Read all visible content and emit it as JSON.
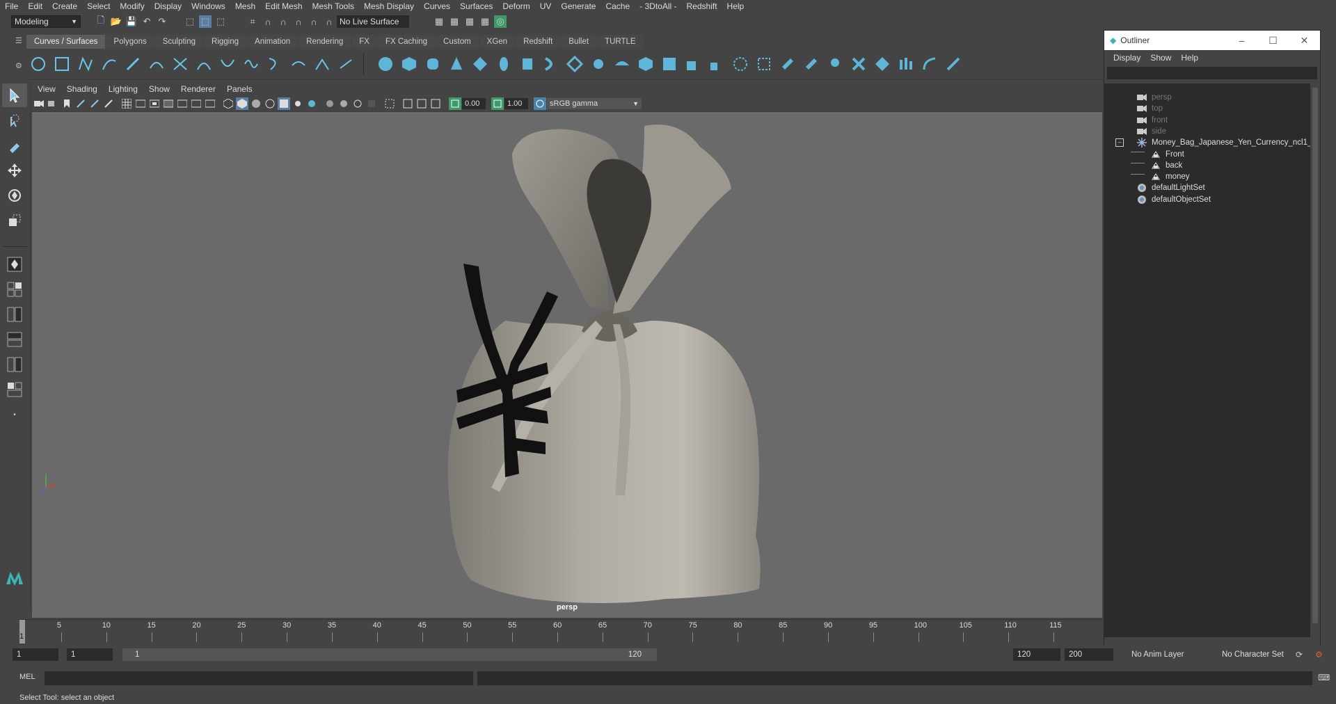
{
  "menubar": {
    "items": [
      "File",
      "Edit",
      "Create",
      "Select",
      "Modify",
      "Display",
      "Windows",
      "Mesh",
      "Edit Mesh",
      "Mesh Tools",
      "Mesh Display",
      "Curves",
      "Surfaces",
      "Deform",
      "UV",
      "Generate",
      "Cache",
      "- 3DtoAll -",
      "Redshift",
      "Help"
    ]
  },
  "statusline": {
    "workspace": "Modeling",
    "live_surface": "No Live Surface"
  },
  "shelf": {
    "tabs": [
      "Curves / Surfaces",
      "Polygons",
      "Sculpting",
      "Rigging",
      "Animation",
      "Rendering",
      "FX",
      "FX Caching",
      "Custom",
      "XGen",
      "Redshift",
      "Bullet",
      "TURTLE"
    ],
    "active_tab": "Curves / Surfaces"
  },
  "viewport": {
    "menu": [
      "View",
      "Shading",
      "Lighting",
      "Show",
      "Renderer",
      "Panels"
    ],
    "exposure": "0.00",
    "gamma": "1.00",
    "color_space": "sRGB gamma",
    "camera_label": "persp"
  },
  "outliner": {
    "title": "Outliner",
    "menu": [
      "Display",
      "Show",
      "Help"
    ],
    "items": [
      {
        "label": "persp",
        "depth": 0,
        "type": "camera",
        "dim": true
      },
      {
        "label": "top",
        "depth": 0,
        "type": "camera",
        "dim": true
      },
      {
        "label": "front",
        "depth": 0,
        "type": "camera",
        "dim": true
      },
      {
        "label": "side",
        "depth": 0,
        "type": "camera",
        "dim": true
      },
      {
        "label": "Money_Bag_Japanese_Yen_Currency_ncl1_1",
        "depth": 0,
        "type": "group",
        "dim": false
      },
      {
        "label": "Front",
        "depth": 1,
        "type": "mesh",
        "dim": false
      },
      {
        "label": "back",
        "depth": 1,
        "type": "mesh",
        "dim": false
      },
      {
        "label": "money",
        "depth": 1,
        "type": "mesh",
        "dim": false
      },
      {
        "label": "defaultLightSet",
        "depth": 0,
        "type": "set",
        "dim": false
      },
      {
        "label": "defaultObjectSet",
        "depth": 0,
        "type": "set",
        "dim": false
      }
    ]
  },
  "timeline": {
    "ticks": [
      "1",
      "5",
      "10",
      "15",
      "20",
      "25",
      "30",
      "35",
      "40",
      "45",
      "50",
      "55",
      "60",
      "65",
      "70",
      "75",
      "80",
      "85",
      "90",
      "95",
      "100",
      "105",
      "110",
      "115"
    ],
    "current_frame": "1"
  },
  "range": {
    "start": "1",
    "current": "1",
    "range_start": "1",
    "range_end": "120",
    "end": "120",
    "max_end": "200",
    "anim_layer": "No Anim Layer",
    "char_set": "No Character Set"
  },
  "command": {
    "lang": "MEL"
  },
  "helpline": {
    "text": "Select Tool: select an object"
  }
}
